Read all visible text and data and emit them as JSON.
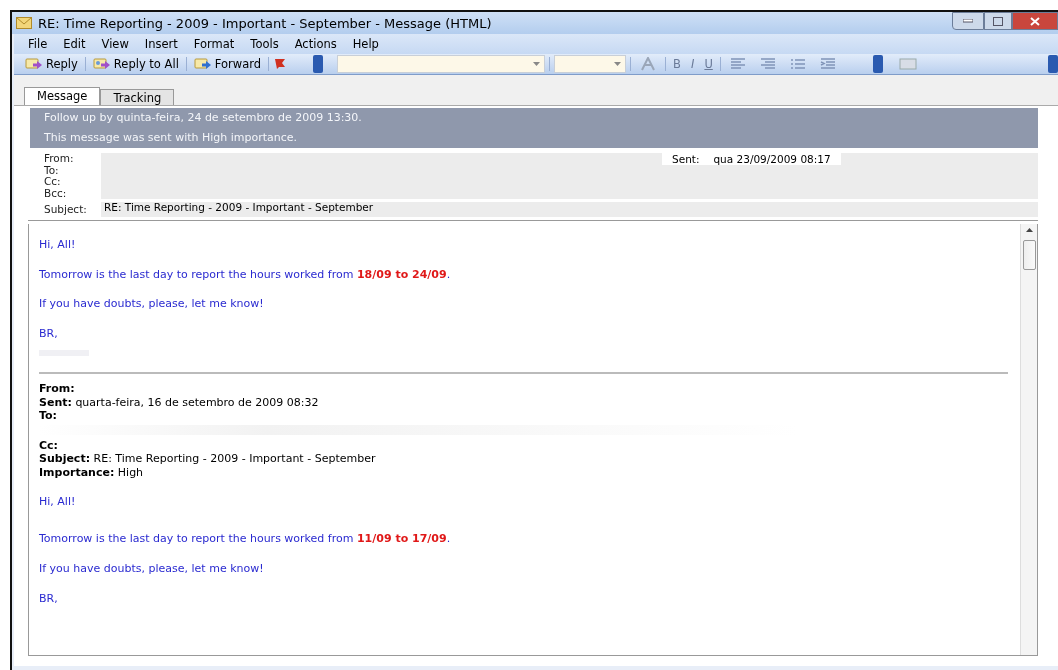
{
  "window": {
    "title": "RE: Time Reporting - 2009 - Important -  September - Message (HTML)"
  },
  "menu": [
    {
      "label": "File"
    },
    {
      "label": "Edit"
    },
    {
      "label": "View"
    },
    {
      "label": "Insert"
    },
    {
      "label": "Format"
    },
    {
      "label": "Tools"
    },
    {
      "label": "Actions"
    },
    {
      "label": "Help"
    }
  ],
  "toolbar": {
    "actions": [
      {
        "label": "Reply",
        "kind": "reply"
      },
      {
        "label": "Reply to All",
        "kind": "reply-all"
      },
      {
        "label": "Forward",
        "kind": "forward"
      }
    ],
    "format": [
      {
        "kind": "font-color"
      },
      {
        "kind": "bold",
        "label": "B"
      },
      {
        "kind": "italic",
        "label": "I"
      },
      {
        "kind": "underline",
        "label": "U"
      },
      {
        "kind": "align-left"
      },
      {
        "kind": "align-right"
      },
      {
        "kind": "bullets"
      },
      {
        "kind": "indent"
      }
    ]
  },
  "tabs": [
    {
      "label": "Message",
      "selected": true
    },
    {
      "label": "Tracking",
      "selected": false
    }
  ],
  "info_bar": [
    "Follow up by quinta-feira, 24 de setembro de 2009 13:30.",
    "This message was sent with High importance."
  ],
  "header": {
    "fields": [
      {
        "label": "From:"
      },
      {
        "label": "To:"
      },
      {
        "label": "Cc:"
      },
      {
        "label": "Bcc:"
      },
      {
        "label": "Subject:",
        "value": "RE: Time Reporting - 2009 - Important -  September"
      }
    ],
    "sent": {
      "label": "Sent:",
      "value": "qua 23/09/2009 08:17"
    }
  },
  "body": {
    "paragraphs": [
      "Hi, All!",
      "Tomorrow is the last day to report the hours worked from **18/09 to 24/09**.",
      "If you have doubts, please, let me know!",
      "BR,"
    ],
    "quoted": {
      "headers": [
        {
          "label": "From:"
        },
        {
          "label": "Sent:",
          "value": "quarta-feira, 16 de setembro de 2009 08:32"
        },
        {
          "label": "To:"
        },
        {
          "label": "Cc:"
        },
        {
          "label": "Subject:",
          "value": "RE: Time Reporting - 2009 - Important - September"
        },
        {
          "label": "Importance:",
          "value": "High"
        }
      ],
      "paragraphs": [
        "Hi, All!",
        "Tomorrow is the last day to report the hours worked from **11/09 to 17/09**.",
        "If you have doubts, please, let me know!",
        "BR,"
      ]
    }
  }
}
